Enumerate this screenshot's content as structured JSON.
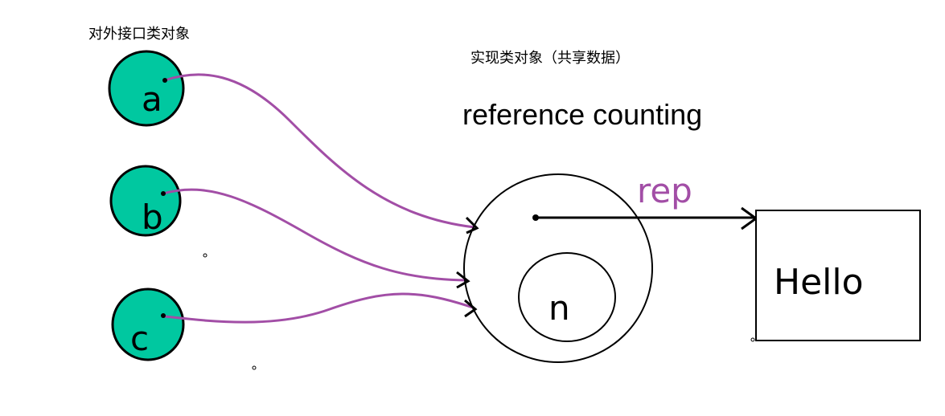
{
  "labels": {
    "external_objects": "对外接口类对象",
    "impl_object": "实现类对象（共享数据）",
    "reference_counting": "reference counting",
    "rep": "rep",
    "n": "n",
    "hello": "Hello"
  },
  "nodes": [
    {
      "label": "a"
    },
    {
      "label": "b"
    },
    {
      "label": "c"
    }
  ],
  "colors": {
    "node_fill": "#00c8a0",
    "arrow_purple": "#a24ea6",
    "stroke": "#000000",
    "rep_text": "#a24ea6"
  }
}
